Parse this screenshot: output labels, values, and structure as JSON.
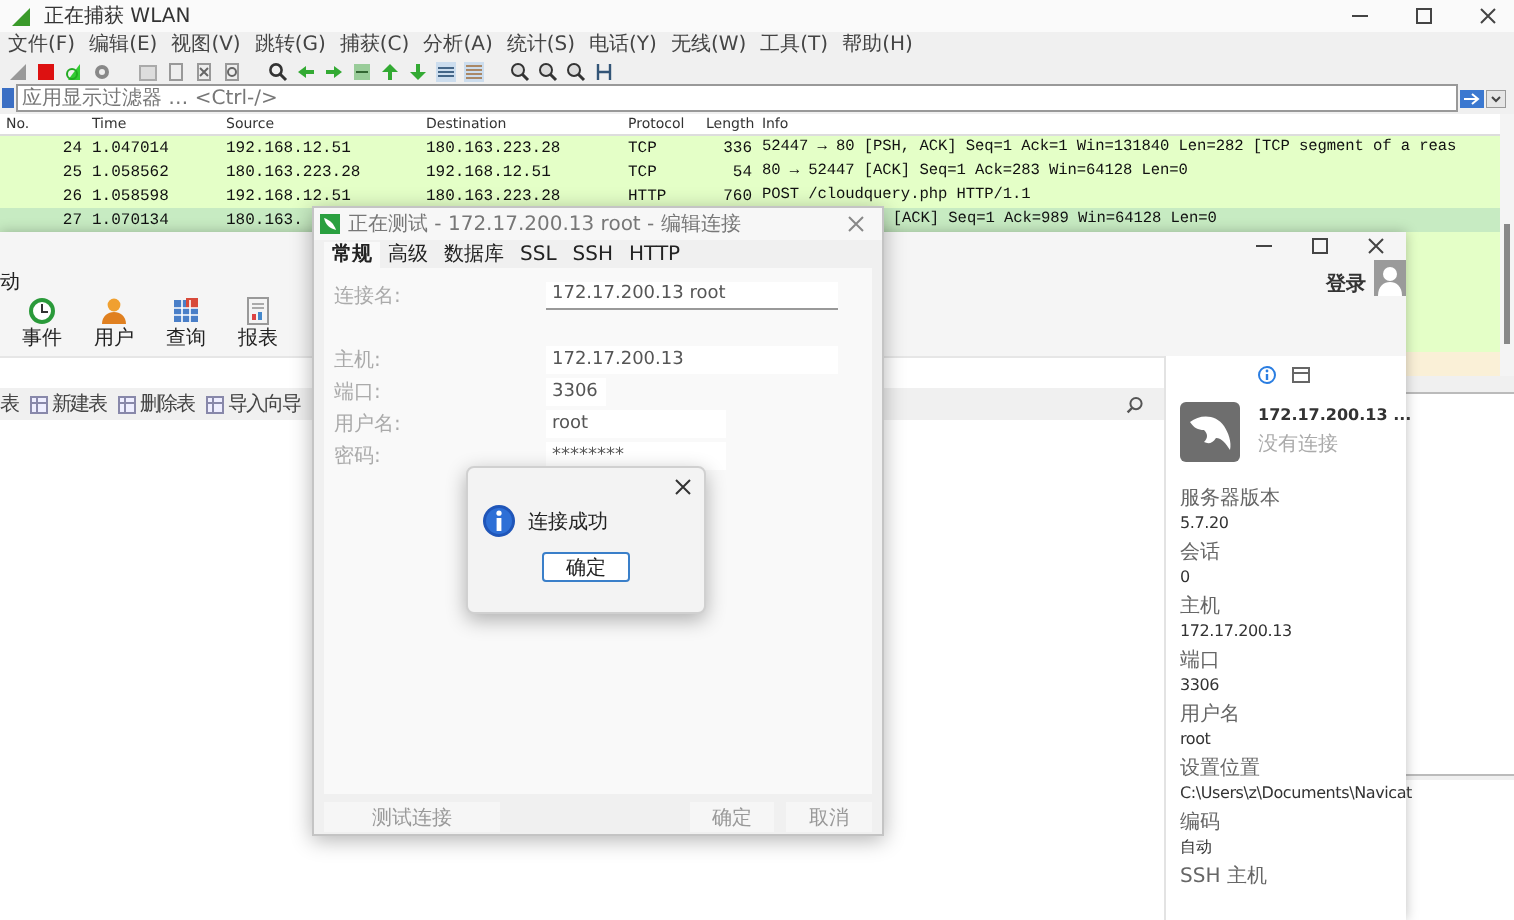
{
  "wireshark": {
    "title": "正在捕获 WLAN",
    "menu": [
      "文件(F)",
      "编辑(E)",
      "视图(V)",
      "跳转(G)",
      "捕获(C)",
      "分析(A)",
      "统计(S)",
      "电话(Y)",
      "无线(W)",
      "工具(T)",
      "帮助(H)"
    ],
    "filter": {
      "placeholder": "应用显示过滤器 … <Ctrl-/>"
    },
    "columns": [
      "No.",
      "Time",
      "Source",
      "Destination",
      "Protocol",
      "Length",
      "Info"
    ],
    "packets": [
      {
        "kind": "full",
        "color": "#e4ffc7",
        "cells": [
          "24",
          "1.047014",
          "192.168.12.51",
          "180.163.223.28",
          "TCP",
          "336",
          "52447 → 80 [PSH, ACK] Seq=1 Ack=1 Win=131840 Len=282 [TCP segment of a reas"
        ]
      },
      {
        "kind": "full",
        "color": "#e4ffc7",
        "cells": [
          "25",
          "1.058562",
          "180.163.223.28",
          "192.168.12.51",
          "TCP",
          "54",
          "80 → 52447 [ACK] Seq=1 Ack=283 Win=64128 Len=0"
        ]
      },
      {
        "kind": "full",
        "color": "#e4ffc7",
        "cells": [
          "26",
          "1.058598",
          "192.168.12.51",
          "180.163.223.28",
          "HTTP",
          "760",
          "POST /cloudquery.php HTTP/1.1"
        ]
      },
      {
        "kind": "covered",
        "color": "#c7ebc2",
        "cells": [
          "27",
          "1.070134",
          "180.163.",
          "[ACK] Seq=1 Ack=989 Win=64128 Len=0"
        ]
      }
    ]
  },
  "navicat": {
    "menu_fragment": "动",
    "login": "登录",
    "tools": [
      "事件",
      "用户",
      "查询",
      "报表"
    ],
    "object_toolbar": [
      "表",
      "新建表",
      "删除表",
      "导入向导"
    ],
    "connection_panel": {
      "name": "172.17.200.13 ...",
      "status": "没有连接",
      "fields": [
        {
          "label": "服务器版本",
          "value": "5.7.20"
        },
        {
          "label": "会话",
          "value": "0"
        },
        {
          "label": "主机",
          "value": "172.17.200.13"
        },
        {
          "label": "端口",
          "value": "3306"
        },
        {
          "label": "用户名",
          "value": "root"
        },
        {
          "label": "设置位置",
          "value": "C:\\Users\\z\\Documents\\Navicat"
        },
        {
          "label": "编码",
          "value": "自动"
        },
        {
          "label": "SSH 主机"
        }
      ]
    }
  },
  "edit_dialog": {
    "title": "正在测试 - 172.17.200.13 root - 编辑连接",
    "tabs": [
      {
        "label": "常规",
        "selected": true
      },
      {
        "label": "高级",
        "selected": false
      },
      {
        "label": "数据库",
        "selected": false
      },
      {
        "label": "SSL",
        "selected": false
      },
      {
        "label": "SSH",
        "selected": false
      },
      {
        "label": "HTTP",
        "selected": false
      }
    ],
    "disabled": true,
    "fields": [
      {
        "label": "连接名:",
        "value": "172.17.200.13 root"
      },
      {
        "label": "主机:",
        "value": "172.17.200.13"
      },
      {
        "label": "端口:",
        "value": "3306"
      },
      {
        "label": "用户名:",
        "value": "root"
      },
      {
        "label": "密码:",
        "value": "********"
      }
    ],
    "buttons": [
      "测试连接",
      "确定",
      "取消"
    ]
  },
  "message_box": {
    "text": "连接成功",
    "button": "确定"
  }
}
